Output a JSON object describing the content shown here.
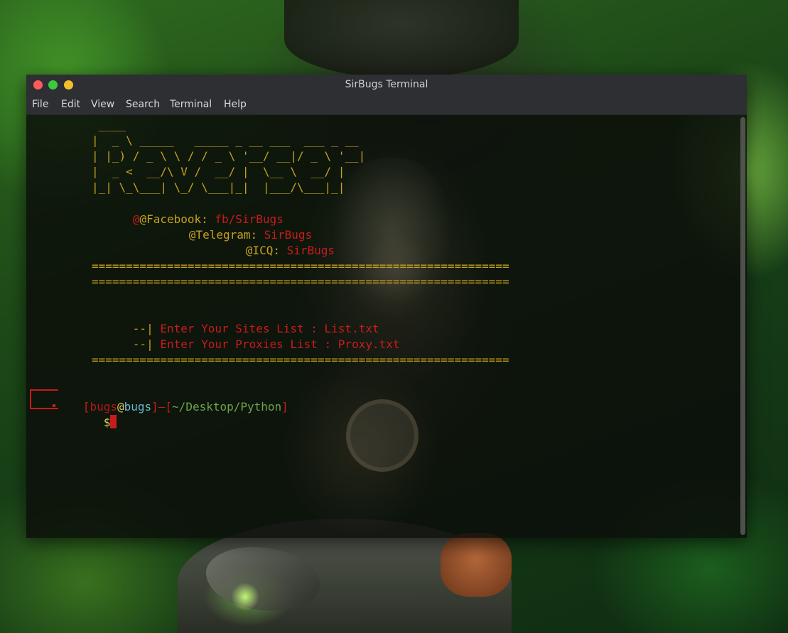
{
  "window": {
    "title": "SirBugs Terminal"
  },
  "menu": {
    "file": "File",
    "edit": "Edit",
    "view": "View",
    "search": "Search",
    "terminal": "Terminal",
    "help": "Help"
  },
  "banner": {
    "line1": " ____",
    "line2": "|  _ \\ _____   _____ _ __ ___  ___ _ __",
    "line3": "| |_) / _ \\ \\ / / _ \\ '__/ __|/ _ \\ '__|",
    "line4": "|  _ <  __/\\ V /  __/ |  \\__ \\  __/ |",
    "line5": "|_| \\_\\___| \\_/ \\___|_|  |___/\\___|_|"
  },
  "contacts": {
    "facebook_label": "@Facebook:",
    "facebook_value": "fb/SirBugs",
    "telegram_label": "@Telegram:",
    "telegram_value": "SirBugs",
    "icq_label": "@ICQ:",
    "icq_value": "SirBugs"
  },
  "separator": "=============================================================",
  "prompts": {
    "marker": "--|",
    "sites_text": "Enter Your Sites List : List.txt",
    "proxies_text": "Enter Your Proxies List : Proxy.txt"
  },
  "shell": {
    "user": "bugs",
    "at": "@",
    "host": "bugs",
    "path": "~/Desktop/Python",
    "dollar": "$"
  },
  "colors": {
    "banner": "#c6a11f",
    "accent_red": "#c81c1c",
    "host_cyan": "#6bb8d0",
    "path_green": "#6ea44a"
  }
}
